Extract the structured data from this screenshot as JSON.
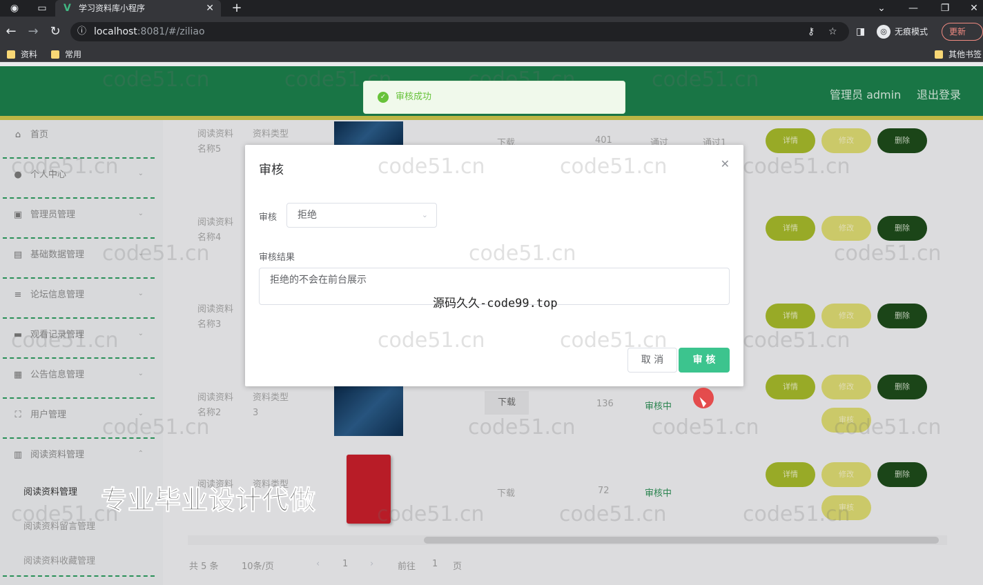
{
  "browser": {
    "tab_title": "学习资料库小程序",
    "url_host": "localhost",
    "url_path": ":8081/#/ziliao",
    "incognito_label": "无痕模式",
    "update_label": "更新",
    "bookmarks": [
      "资料",
      "常用"
    ],
    "other_bookmarks": "其他书签"
  },
  "header": {
    "user_label": "管理员 admin",
    "logout_label": "退出登录"
  },
  "toast": {
    "message": "审核成功"
  },
  "sidebar": {
    "items": [
      {
        "label": "首页",
        "icon": "home-icon"
      },
      {
        "label": "个人中心",
        "icon": "user-icon"
      },
      {
        "label": "管理员管理",
        "icon": "admin-icon"
      },
      {
        "label": "基础数据管理",
        "icon": "data-icon"
      },
      {
        "label": "论坛信息管理",
        "icon": "forum-icon"
      },
      {
        "label": "观看记录管理",
        "icon": "record-icon"
      },
      {
        "label": "公告信息管理",
        "icon": "notice-icon"
      },
      {
        "label": "用户管理",
        "icon": "users-icon"
      },
      {
        "label": "阅读资料管理",
        "icon": "book-icon"
      }
    ],
    "subitems": [
      "阅读资料管理",
      "阅读资料留言管理",
      "阅读资料收藏管理"
    ]
  },
  "table": {
    "rows": [
      {
        "name": "阅读资料名称5",
        "type": "资料类型",
        "download": "下载",
        "views": "401",
        "status": "通过",
        "result": "通过1"
      },
      {
        "name": "阅读资料名称4",
        "type": "",
        "download": "",
        "views": "",
        "status": "",
        "result": ""
      },
      {
        "name": "阅读资料名称3",
        "type": "",
        "download": "",
        "views": "",
        "status": "",
        "result": ""
      },
      {
        "name": "阅读资料名称2",
        "type": "资料类型3",
        "download": "下载",
        "views": "136",
        "status": "审核中",
        "result": ""
      },
      {
        "name": "阅读资料",
        "type": "资料类型",
        "download": "下载",
        "views": "72",
        "status": "审核中",
        "result": ""
      }
    ],
    "actions": {
      "detail": "详情",
      "edit": "修改",
      "delete": "删除",
      "review": "审核"
    }
  },
  "pager": {
    "total": "共 5 条",
    "page_size": "10条/页",
    "current": "1",
    "goto_prefix": "前往",
    "goto_value": "1",
    "goto_suffix": "页"
  },
  "dialog": {
    "title": "审核",
    "review_label": "审核",
    "review_value": "拒绝",
    "result_label": "审核结果",
    "result_value": "拒绝的不会在前台展示",
    "cancel_label": "取 消",
    "confirm_label": "审 核"
  },
  "overlay_text": {
    "source_line": "源码久久-code99.top",
    "promo": "专业毕业设计代做",
    "watermark": "code51.cn"
  },
  "colors": {
    "header_bg": "#1b7d4a",
    "accent_green": "#3cc48e",
    "success": "#67c23a"
  }
}
